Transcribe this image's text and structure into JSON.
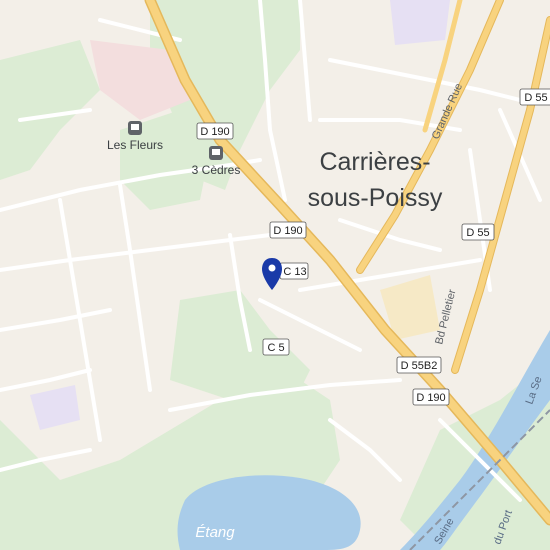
{
  "map": {
    "town_name_line1": "Carrières-",
    "town_name_line2": "sous-Poissy",
    "places": {
      "les_fleurs": "Les Fleurs",
      "trois_cedres": "3 Cèdres"
    },
    "road_labels": {
      "d190_top": "D 190",
      "d190_mid": "D 190",
      "d190_bottom": "D 190",
      "c13": "C 13",
      "c5": "C 5",
      "d55b2": "D 55B2",
      "d55_top": "D 55",
      "d55_mid": "D 55"
    },
    "street_labels": {
      "grande_rue": "Grande Rue",
      "bd_pelletier": "Bd Pelletier",
      "quai_port": "du Port",
      "la_seine": "La Se",
      "seine_lower": "Seine"
    },
    "water": {
      "etang": "Étang"
    },
    "colors": {
      "land": "#f3efe8",
      "park": "#dcecd4",
      "water": "#a9cce9",
      "major_road": "#f8d37f",
      "major_road_edge": "#e5b85b",
      "minor_road": "#ffffff",
      "marker": "#1a3aa8",
      "rail": "#8e96a3"
    },
    "icons": [
      "bus-stop-icon",
      "location-pin-icon"
    ]
  }
}
